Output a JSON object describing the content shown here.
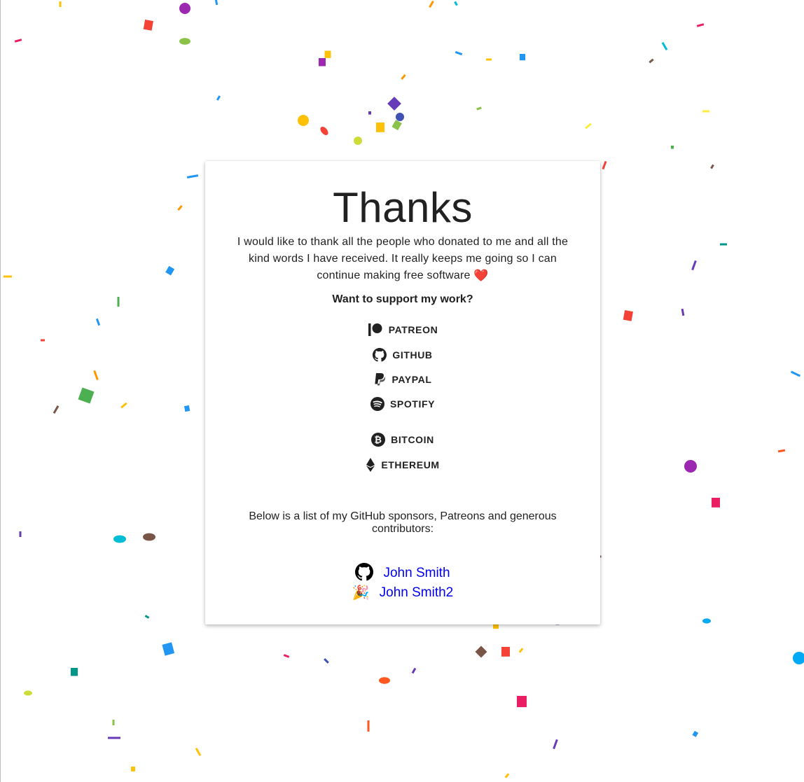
{
  "card": {
    "title": "Thanks",
    "intro": "I would like to thank all the people who donated to me and all the kind words I have received. It really keeps me going so I can continue making free software",
    "heart": "❤️",
    "support_heading": "Want to support my work?"
  },
  "donation_links": [
    {
      "label": "PATREON",
      "icon": "patreon-icon"
    },
    {
      "label": "GITHUB",
      "icon": "github-icon"
    },
    {
      "label": "PAYPAL",
      "icon": "paypal-icon"
    },
    {
      "label": "SPOTIFY",
      "icon": "spotify-icon"
    },
    {
      "label": "BITCOIN",
      "icon": "bitcoin-icon"
    },
    {
      "label": "ETHEREUM",
      "icon": "ethereum-icon"
    }
  ],
  "sponsors": {
    "intro": "Below is a list of my GitHub sponsors, Patreons and generous contributors:",
    "list": [
      {
        "name": "John Smith",
        "icon": "github-icon"
      },
      {
        "name": "John Smith2",
        "icon": "party-popper-emoji",
        "emoji": "🎉"
      }
    ]
  },
  "colors": {
    "link": "#0000ee",
    "text": "#212121",
    "confetti": [
      "#f44336",
      "#e91e63",
      "#9c27b0",
      "#673ab7",
      "#3f51b5",
      "#2196f3",
      "#03a9f4",
      "#00bcd4",
      "#009688",
      "#4caf50",
      "#8bc34a",
      "#cddc39",
      "#ffeb3b",
      "#ffc107",
      "#ff9800",
      "#ff5722",
      "#795548"
    ]
  }
}
